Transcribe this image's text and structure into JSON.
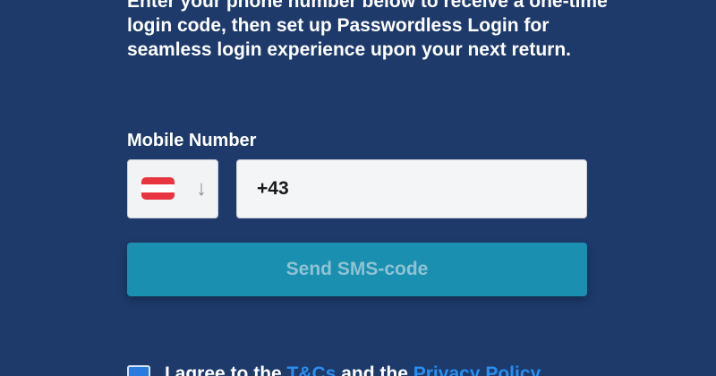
{
  "intro": {
    "text": "Enter your phone number below to receive a one-time login code, then set up Passwordless Login for seamless login experience upon your next return."
  },
  "mobile": {
    "label": "Mobile Number",
    "country_arrow": "↓",
    "phone_value": "+43"
  },
  "send_button": {
    "label": "Send SMS-code"
  },
  "terms": {
    "prefix": "I agree to the",
    "tcs_link": "T&Cs",
    "middle": "and the",
    "privacy_link": "Privacy Policy"
  },
  "colors": {
    "background": "#1d3a6b",
    "button": "#1a8fb0",
    "link": "#2a8ef0",
    "flag_red": "#e8343f"
  },
  "icons": {
    "flag": "austria-flag-icon",
    "arrow": "arrow-down-icon",
    "checkbox": "checkbox-checked-icon"
  }
}
